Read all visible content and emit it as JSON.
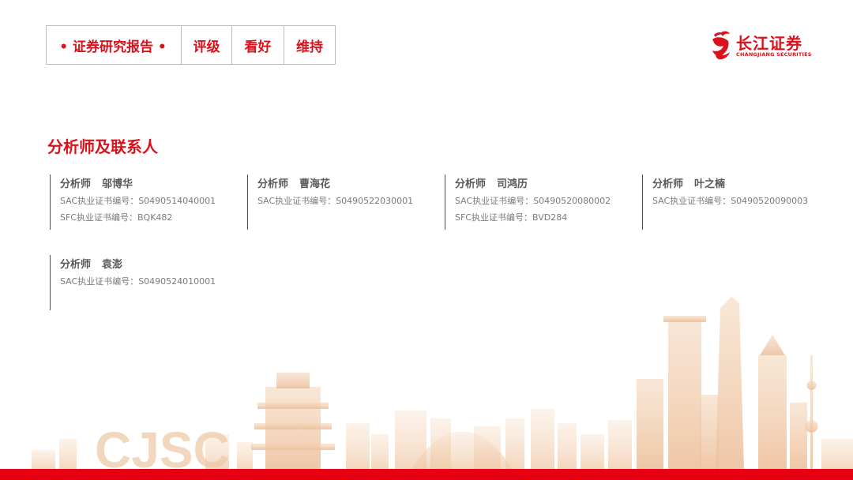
{
  "header": {
    "report_type": "• 证券研究报告 •",
    "rating_label": "评级",
    "rating_value": "看好",
    "rating_action": "维持"
  },
  "logo": {
    "name_cn": "长江证券",
    "name_en": "CHANGJIANG SECURITIES"
  },
  "section": {
    "title": "分析师及联系人"
  },
  "analysts": [
    {
      "role": "分析师",
      "name": "邬博华",
      "certs": [
        "SAC执业证书编号：S0490514040001",
        "SFC执业证书编号：BQK482"
      ]
    },
    {
      "role": "分析师",
      "name": "曹海花",
      "certs": [
        "SAC执业证书编号：S0490522030001"
      ]
    },
    {
      "role": "分析师",
      "name": "司鸿历",
      "certs": [
        "SAC执业证书编号：S0490520080002",
        "SFC执业证书编号：BVD284"
      ]
    },
    {
      "role": "分析师",
      "name": "叶之楠",
      "certs": [
        "SAC执业证书编号：S0490520090003"
      ]
    },
    {
      "role": "分析师",
      "name": "袁澎",
      "certs": [
        "SAC执业证书编号：S0490524010001"
      ]
    }
  ],
  "watermark": {
    "text": "CJSC"
  },
  "colors": {
    "brand_red": "#d9121b",
    "bar_red": "#e60012",
    "skyline": "#f2d3b8"
  }
}
